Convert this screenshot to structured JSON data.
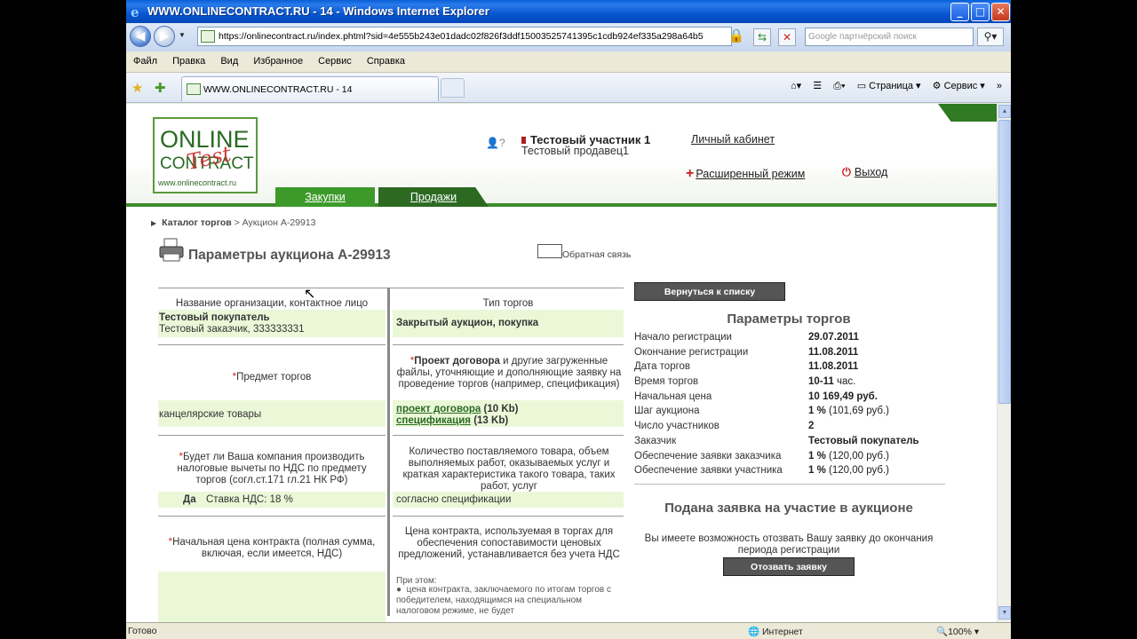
{
  "window": {
    "title": "WWW.ONLINECONTRACT.RU - 14 - Windows Internet Explorer",
    "buttons": {
      "minimize": "_",
      "maximize": "□",
      "close": "✕"
    }
  },
  "address": {
    "url": "https://onlinecontract.ru/index.phtml?sid=4e555b243e01dadc02f826f3ddf15003525741395c1cdb924ef335a298a64b5",
    "search_placeholder": "Google партнёрский поиск"
  },
  "menu": [
    "Файл",
    "Правка",
    "Вид",
    "Избранное",
    "Сервис",
    "Справка"
  ],
  "tab": {
    "title": "WWW.ONLINECONTRACT.RU - 14"
  },
  "tools": {
    "page": "Страница",
    "service": "Сервис"
  },
  "status": {
    "text": "Готово",
    "zone": "Интернет",
    "zoom": "100%"
  },
  "site": {
    "logo": {
      "line1": "ONLINE",
      "line2": "CONTRACT",
      "line3": "www.onlinecontract.ru",
      "stamp": "Test"
    },
    "user_name": "Тестовый участник 1",
    "user_sub": "Тестовый продавец1",
    "cabinet_link": "Личный кабинет",
    "extended_mode": "Расширенный режим",
    "exit": "Выход",
    "tab_buy": "Закупки",
    "tab_sell": "Продажи"
  },
  "breadcrumb": {
    "root": "Каталог торгов",
    "sep": " > ",
    "current": "Аукцион А-29913"
  },
  "page_title": "Параметры аукциона А-29913",
  "feedback": "Обратная связь",
  "left_table": {
    "col1_header": "Название организации, контактное лицо",
    "col2_header": "Тип торгов",
    "org_name": "Тестовый покупатель",
    "org_contact": "Тестовый заказчик, 333333331",
    "auction_type": "Закрытый аукцион, покупка",
    "subject_label": "Предмет торгов",
    "docs_bold": "Проект договора",
    "docs_rest": " и другие загруженные файлы, уточняющие и дополняющие заявку на проведение торгов (например, спецификация)",
    "subject_value": "канцелярские товары",
    "doc1_link": "проект договора",
    "doc1_size": " (10 Kb)",
    "doc2_link": "спецификация",
    "doc2_size": " (13 Kb)",
    "vat_question": "Будет ли Ваша компания производить налоговые вычеты по НДС по предмету торгов (согл.ст.171 гл.21 НК РФ)",
    "quantity_label": "Количество поставляемого товара, объем выполняемых работ, оказываемых услуг и краткая характеристика такого товара, таких работ, услуг",
    "vat_answer": "Да",
    "vat_rate": "Ставка НДС: 18 %",
    "quantity_value": "согласно спецификации",
    "start_price_label": "Начальная цена контракта (полная сумма, включая, если имеется, НДС)",
    "price_note": "Цена контракта, используемая в торгах для обеспечения сопоставимости ценовых предложений, устанавливается без учета НДС",
    "price_note2": "При этом:",
    "price_bullet": "цена контракта, заключаемого по итогам торгов с победителем, находящимся на специальном налоговом режиме, не будет"
  },
  "right_panel": {
    "back_button": "Вернуться к списку",
    "params_title": "Параметры торгов",
    "params": [
      {
        "label": "Начало регистрации",
        "value": "29.07.2011",
        "extra": ""
      },
      {
        "label": "Окончание регистрации",
        "value": "11.08.2011",
        "extra": ""
      },
      {
        "label": "Дата торгов",
        "value": "11.08.2011",
        "extra": ""
      },
      {
        "label": "Время торгов",
        "value": "10-11",
        "extra": " час."
      },
      {
        "label": "Начальная цена",
        "value": "10 169,49 руб.",
        "extra": ""
      },
      {
        "label": "Шаг аукциона",
        "value": "1 %",
        "extra": " (101,69 руб.)"
      },
      {
        "label": "Число участников",
        "value": "2",
        "extra": ""
      },
      {
        "label": "Заказчик",
        "value": "Тестовый покупатель",
        "extra": ""
      },
      {
        "label": "Обеспечение заявки заказчика",
        "value": "1 %",
        "extra": " (120,00 руб.)"
      },
      {
        "label": "Обеспечение заявки участника",
        "value": "1 %",
        "extra": " (120,00 руб.)"
      }
    ],
    "applied_title": "Подана заявка на участие в аукционе",
    "applied_text": "Вы имеете возможность отозвать Вашу заявку до окончания периода регистрации",
    "revoke_button": "Отозвать заявку"
  }
}
